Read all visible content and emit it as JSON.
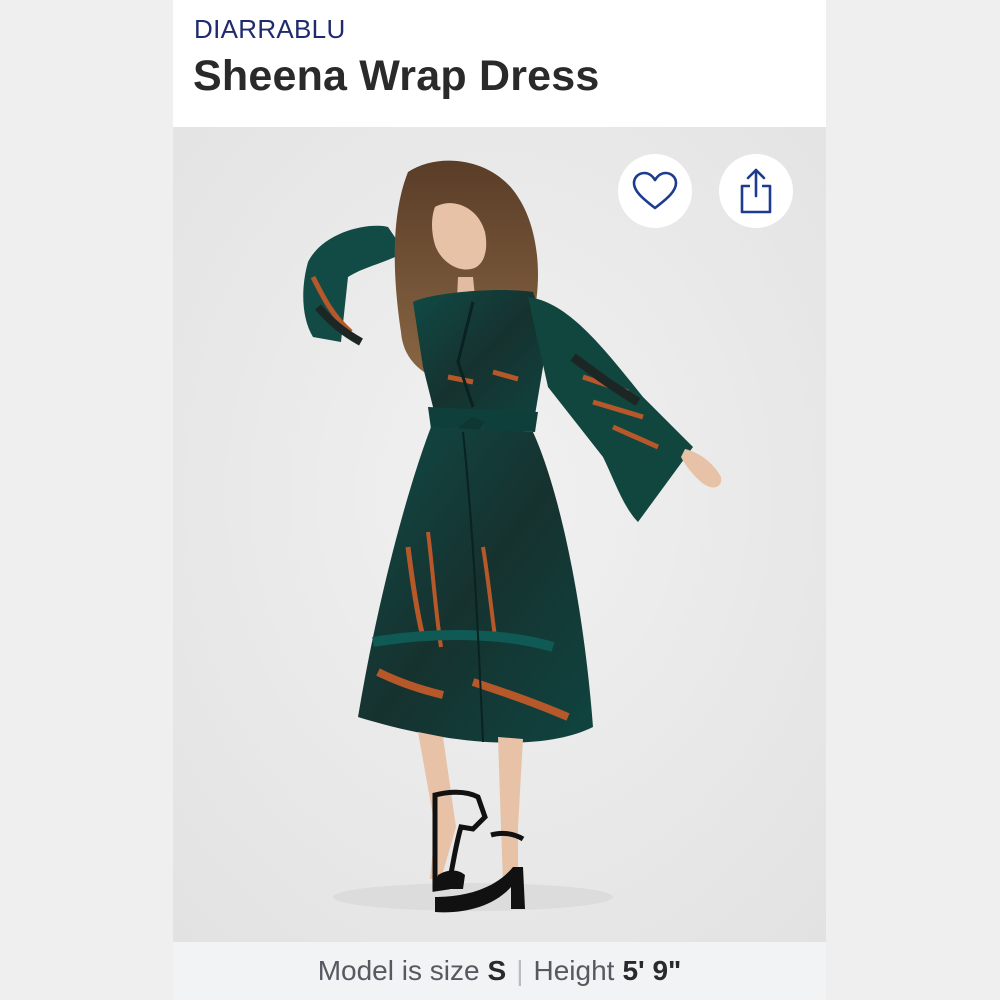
{
  "product": {
    "brand": "DIARRABLU",
    "name": "Sheena Wrap Dress"
  },
  "actions": {
    "favorite_icon": "heart-outline-icon",
    "share_icon": "share-upload-icon"
  },
  "image": {
    "description_alt": "Model wearing teal printed wrap dress with bell sleeves and black heeled sandals"
  },
  "model_info": {
    "size_label": "Model is size",
    "size_value": "S",
    "separator": "|",
    "height_label": "Height",
    "height_value": "5' 9\""
  },
  "colors": {
    "brand": "#1f2b6c",
    "dress_teal": "#0f4a45",
    "dress_dark": "#1c2624",
    "print_orange": "#b6582a",
    "accent_blue": "#1f3b8f"
  }
}
